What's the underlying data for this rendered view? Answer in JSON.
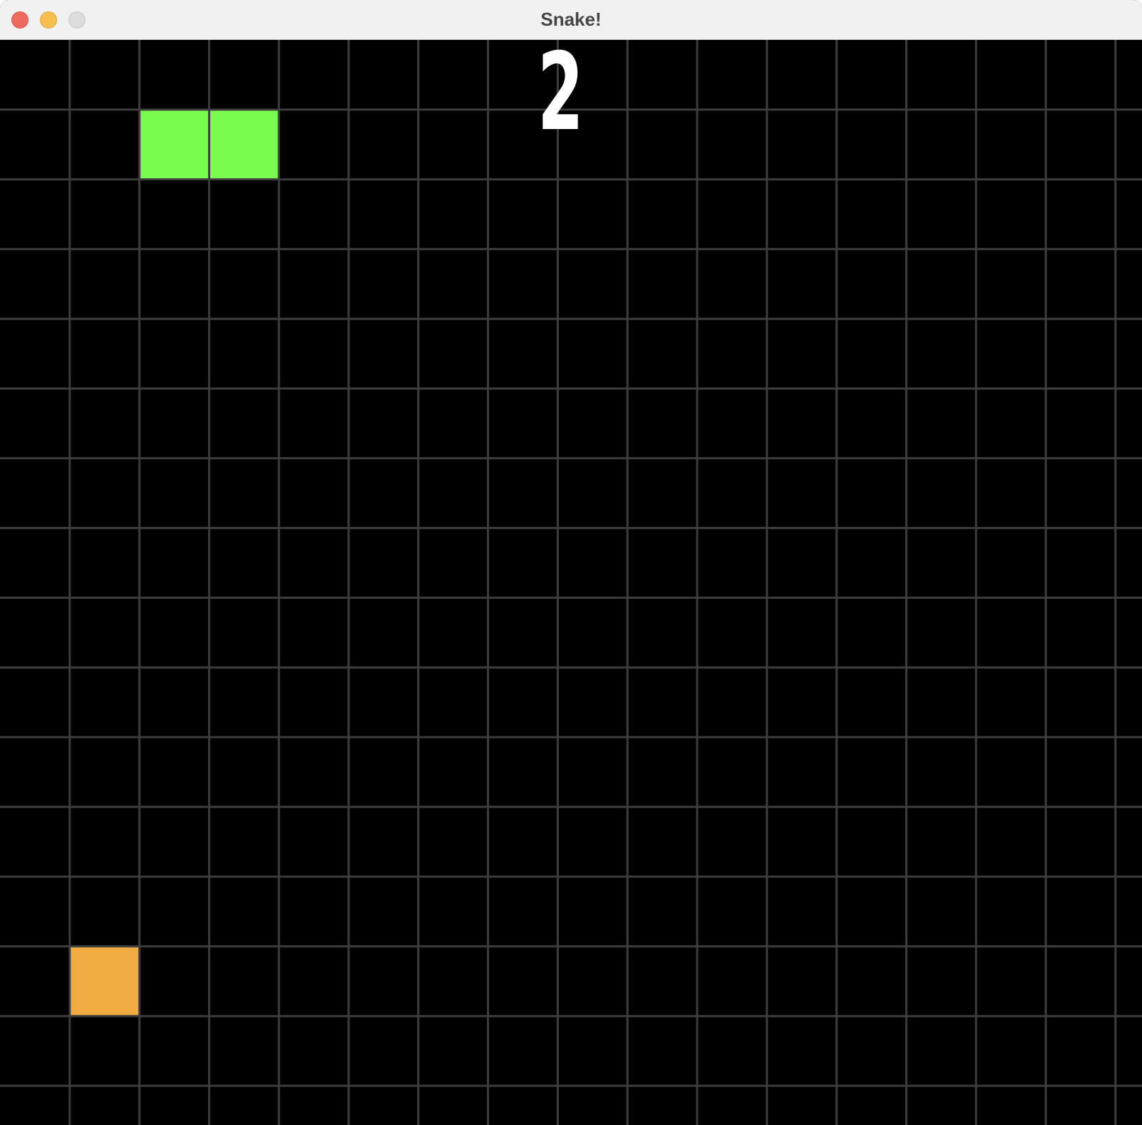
{
  "window": {
    "title": "Snake!",
    "controls": [
      "close-icon",
      "minimize-icon",
      "maximize-icon"
    ]
  },
  "game": {
    "score": "2",
    "grid": {
      "columns": 16,
      "rows": 16
    },
    "snake": {
      "color": "#7afc4f",
      "cells": [
        [
          2,
          1
        ],
        [
          3,
          1
        ]
      ]
    },
    "food": {
      "color": "#f0ac43",
      "cell": [
        1,
        13
      ]
    },
    "colors": {
      "background": "#000000",
      "grid_line": "#3d3d3d",
      "score": "#ffffff"
    }
  }
}
